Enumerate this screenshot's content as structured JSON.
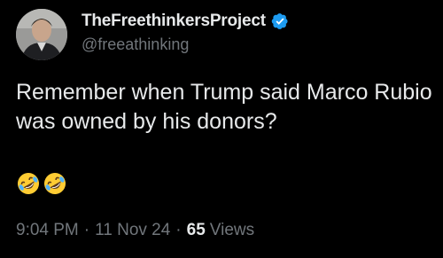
{
  "author": {
    "display_name": "TheFreethinkersProject",
    "handle": "@freeathinking",
    "verified": true,
    "verified_color": "#1d9bf0",
    "avatar_icon": "person-avatar-photo"
  },
  "tweet": {
    "text": "Remember when Trump said Marco Rubio was owned by his donors?",
    "emojis": [
      "rolling-on-floor-laughing",
      "rolling-on-floor-laughing"
    ]
  },
  "meta": {
    "time": "9:04 PM",
    "separator": "·",
    "date": "11 Nov 24",
    "views_count": "65",
    "views_label": "Views"
  },
  "colors": {
    "background": "#000000",
    "primary_text": "#e7e9ea",
    "secondary_text": "#71767b",
    "accent": "#1d9bf0"
  }
}
